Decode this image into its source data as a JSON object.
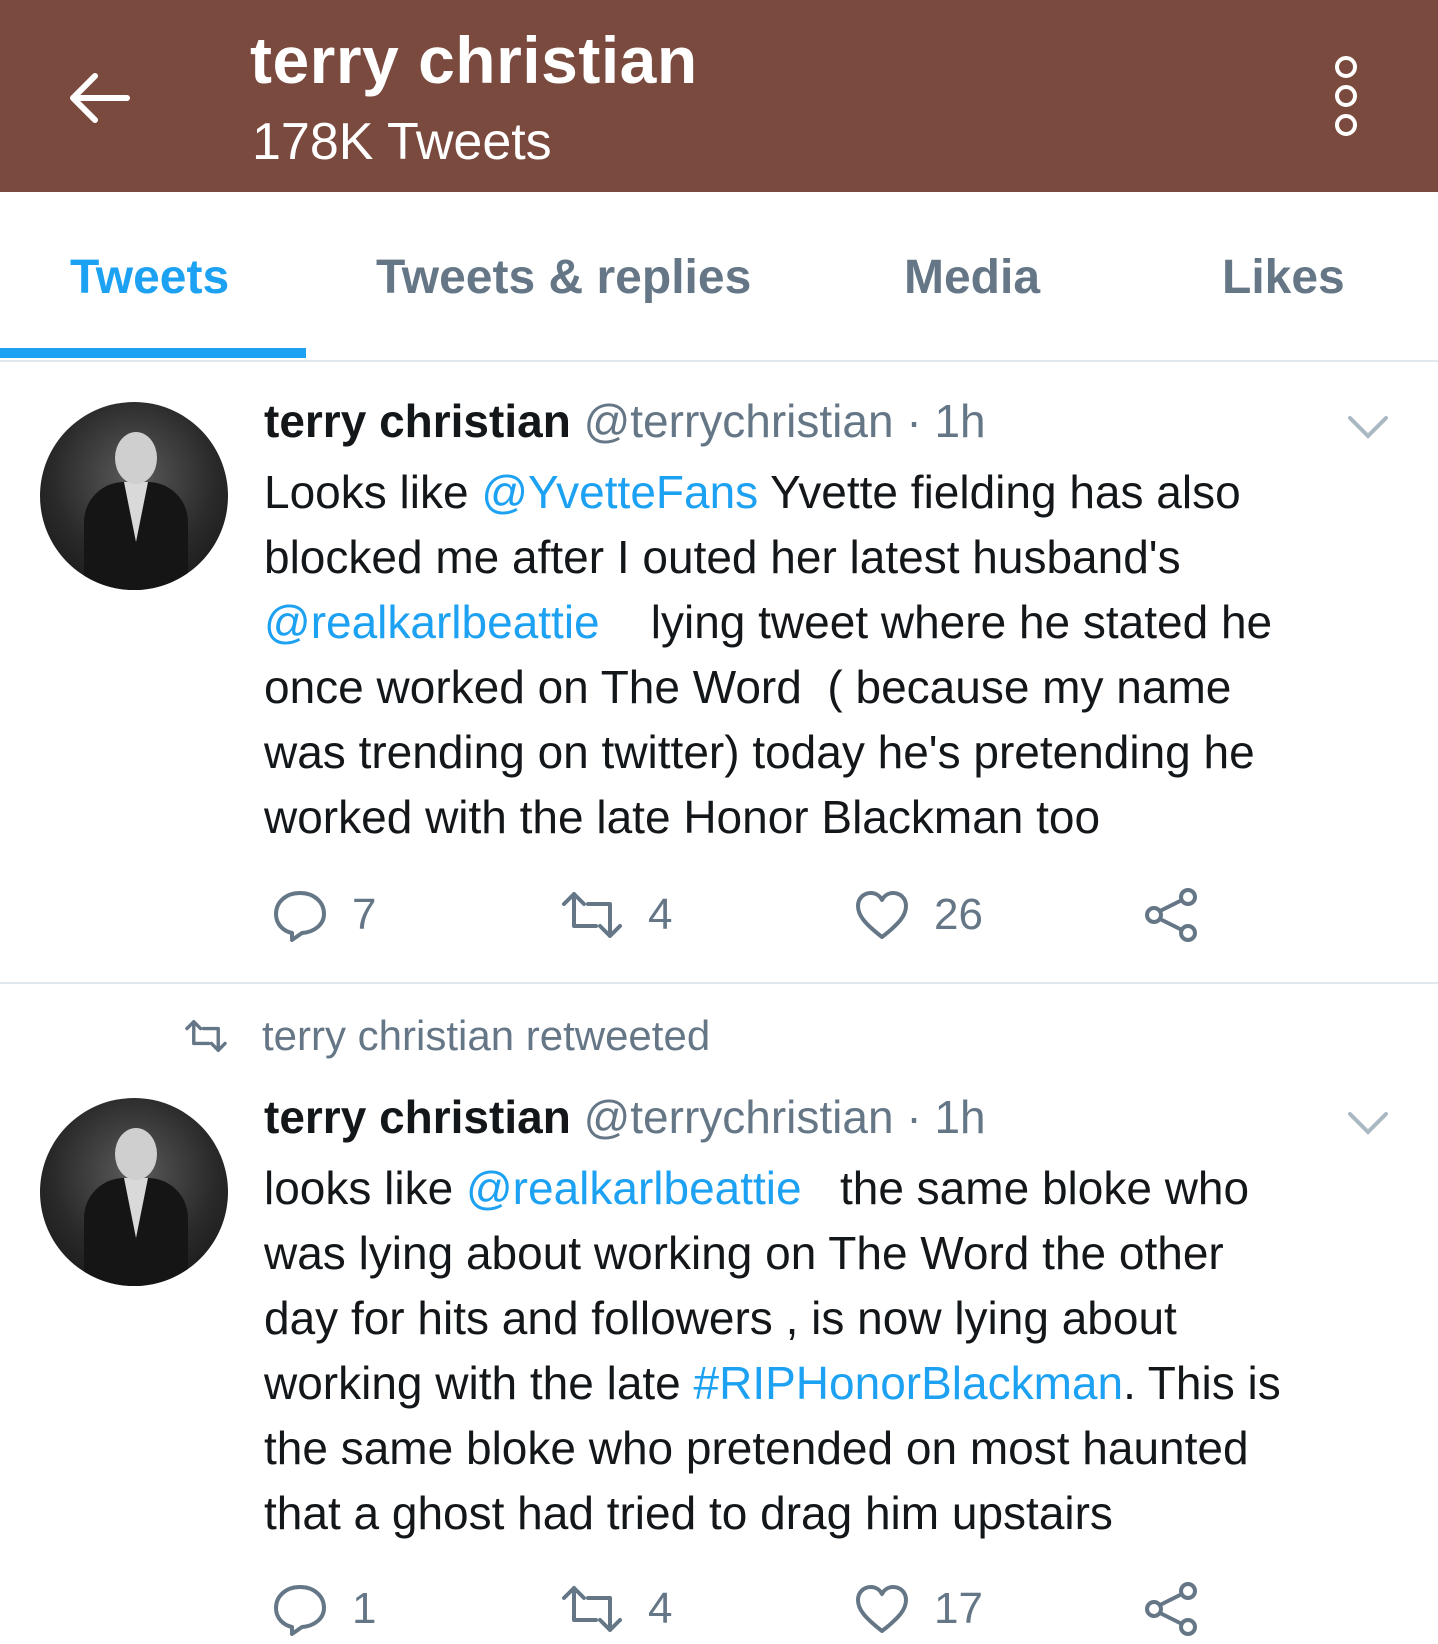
{
  "header": {
    "title": "terry christian",
    "subtitle": "178K Tweets",
    "bg_color": "#7b4a3e"
  },
  "tabs": [
    {
      "label": "Tweets",
      "active": true
    },
    {
      "label": "Tweets & replies",
      "active": false
    },
    {
      "label": "Media",
      "active": false
    },
    {
      "label": "Likes",
      "active": false
    }
  ],
  "accent_color": "#1da1f2",
  "tweets": [
    {
      "name": "terry christian",
      "handle": "@terrychristian · 1h",
      "lines": [
        {
          "parts": [
            "Looks like ",
            "@YvetteFans",
            " Yvette fielding has also"
          ]
        },
        {
          "parts": [
            "blocked me after I outed her latest husband's"
          ]
        },
        {
          "parts": [
            "",
            "@realkarlbeattie",
            "    lying tweet where he stated he"
          ]
        },
        {
          "parts": [
            "once worked on The Word  ( because my name"
          ]
        },
        {
          "parts": [
            "was trending on twitter) today he's pretending he"
          ]
        },
        {
          "parts": [
            "worked with the late Honor Blackman too"
          ]
        }
      ],
      "replies": "7",
      "retweets": "4",
      "likes": "26"
    },
    {
      "retweeted_by": "terry christian retweeted",
      "name": "terry christian",
      "handle": "@terrychristian · 1h",
      "lines": [
        {
          "parts": [
            "looks like ",
            "@realkarlbeattie",
            "   the same bloke who"
          ]
        },
        {
          "parts": [
            "was lying about working on The Word the other"
          ]
        },
        {
          "parts": [
            "day for hits and followers , is now lying about"
          ]
        },
        {
          "parts": [
            "working with the late ",
            "#RIPHonorBlackman",
            ". This is"
          ]
        },
        {
          "parts": [
            "the same bloke who pretended on most haunted"
          ]
        },
        {
          "parts": [
            "that a ghost had tried to drag him upstairs"
          ]
        }
      ],
      "replies": "1",
      "retweets": "4",
      "likes": "17"
    }
  ],
  "icons": [
    "back-arrow-icon",
    "more-options-icon",
    "chevron-down-icon",
    "reply-icon",
    "retweet-icon",
    "like-icon",
    "share-icon"
  ]
}
